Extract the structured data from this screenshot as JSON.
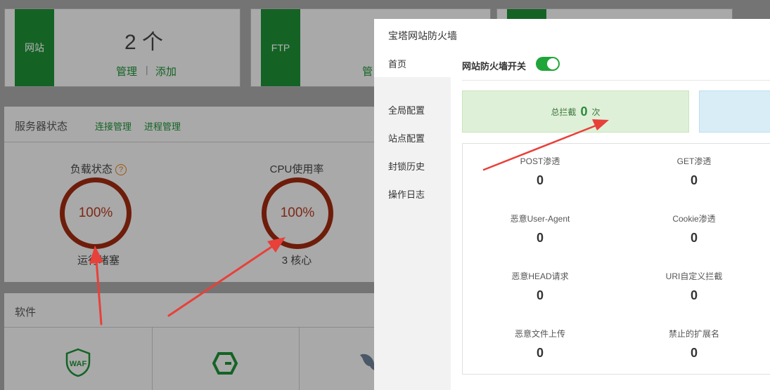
{
  "background": {
    "site_card": {
      "tab": "网站",
      "count": "2 个",
      "manage": "管理",
      "sep": "|",
      "add": "添加"
    },
    "ftp_card": {
      "tab": "FTP",
      "manage": "管"
    },
    "server_status": {
      "title": "服务器状态",
      "link1": "连接管理",
      "link2": "进程管理"
    },
    "load": {
      "label": "负载状态",
      "help": "?",
      "value": "100%",
      "sub": "运行堵塞",
      "percent": 100
    },
    "cpu": {
      "label": "CPU使用率",
      "value": "100%",
      "sub": "3 核心",
      "percent": 100
    },
    "software": {
      "title": "软件",
      "waf_icon_text": "WAF"
    }
  },
  "modal": {
    "title": "宝塔网站防火墙",
    "sidebar": [
      {
        "label": "首页",
        "active": true
      },
      {
        "label": "全局配置",
        "active": false
      },
      {
        "label": "站点配置",
        "active": false
      },
      {
        "label": "封锁历史",
        "active": false
      },
      {
        "label": "操作日志",
        "active": false
      }
    ],
    "switch_label": "网站防火墙开关",
    "switch_on": true,
    "total": {
      "label": "总拦截",
      "value": "0",
      "unit": "次"
    },
    "stats": [
      {
        "name": "POST渗透",
        "value": "0"
      },
      {
        "name": "GET渗透",
        "value": "0"
      },
      {
        "name": "恶意User-Agent",
        "value": "0"
      },
      {
        "name": "Cookie渗透",
        "value": "0"
      },
      {
        "name": "恶意HEAD请求",
        "value": "0"
      },
      {
        "name": "URI自定义拦截",
        "value": "0"
      },
      {
        "name": "恶意文件上传",
        "value": "0"
      },
      {
        "name": "禁止的扩展名",
        "value": "0"
      }
    ]
  },
  "colors": {
    "accent": "#20a53a",
    "brand_green": "#1e8f35",
    "gauge": "#9e2a10",
    "arrow": "#e8403a"
  }
}
